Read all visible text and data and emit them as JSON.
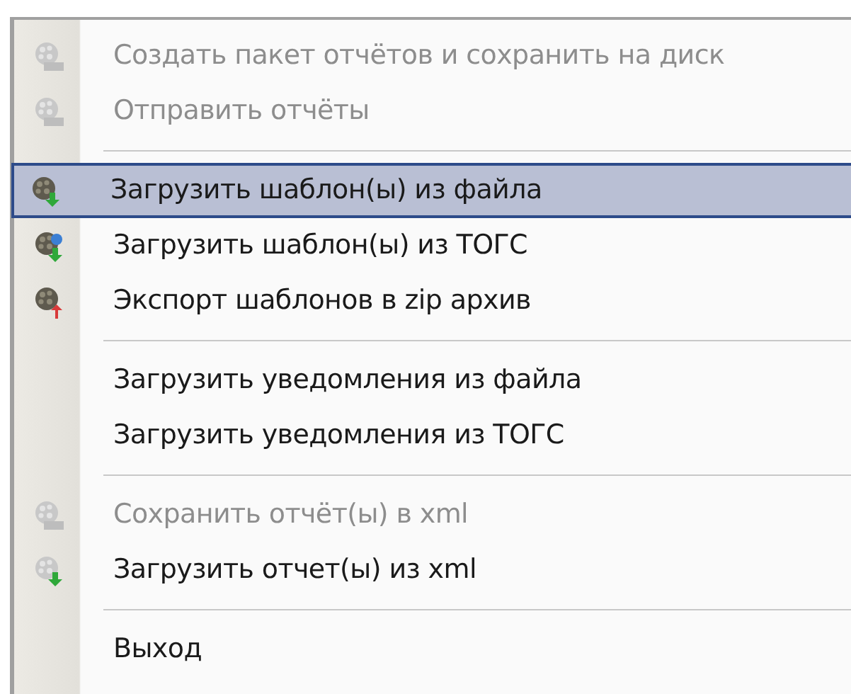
{
  "menu": {
    "items": [
      {
        "kind": "zip",
        "label": "Создать пакет отчётов и сохранить на диск",
        "disabled": true,
        "selected": false
      },
      {
        "kind": "send",
        "label": "Отправить отчёты",
        "disabled": true,
        "selected": false
      },
      {
        "kind": "separator"
      },
      {
        "kind": "download",
        "label": "Загрузить шаблон(ы) из файла",
        "disabled": false,
        "selected": true
      },
      {
        "kind": "globe",
        "label": "Загрузить шаблон(ы) из ТОГС",
        "disabled": false,
        "selected": false
      },
      {
        "kind": "export",
        "label": "Экспорт шаблонов в zip архив",
        "disabled": false,
        "selected": false
      },
      {
        "kind": "separator"
      },
      {
        "kind": "plain",
        "label": "Загрузить уведомления из файла",
        "disabled": false,
        "selected": false
      },
      {
        "kind": "plain",
        "label": "Загрузить уведомления из ТОГС",
        "disabled": false,
        "selected": false
      },
      {
        "kind": "separator"
      },
      {
        "kind": "xml",
        "label": "Сохранить отчёт(ы) в xml",
        "disabled": true,
        "selected": false
      },
      {
        "kind": "xmlload",
        "label": "Загрузить отчет(ы) из xml",
        "disabled": false,
        "selected": false
      },
      {
        "kind": "separator"
      },
      {
        "kind": "plain",
        "label": "Выход",
        "disabled": false,
        "selected": false
      }
    ]
  }
}
